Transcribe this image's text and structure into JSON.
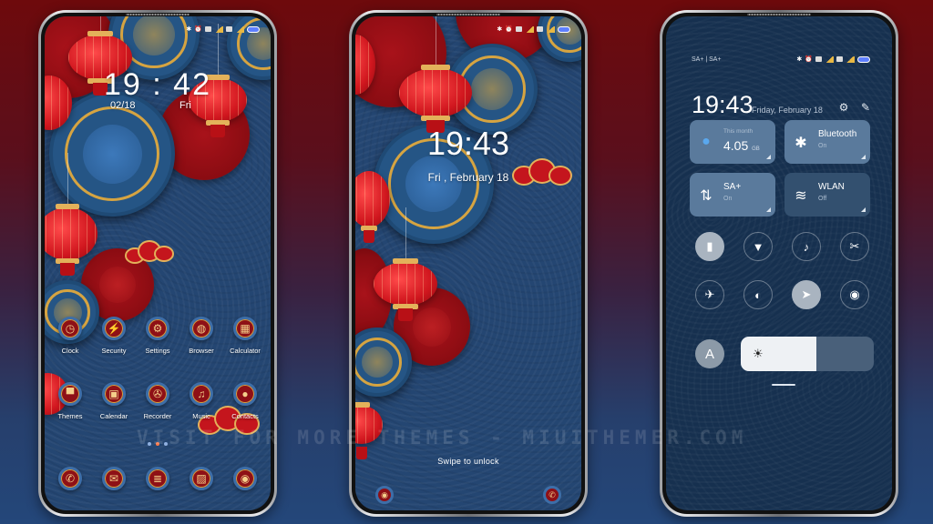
{
  "watermark": "VISIT FOR MORE THEMES - MIUITHEMER.COM",
  "colors": {
    "bg_top": "#6e0a0c",
    "bg_bottom": "#24477a",
    "wallpaper_blue": "#244672",
    "lantern_red": "#d0161e",
    "gold": "#d6a441",
    "cc_background": "#16304f",
    "tile_on": "#5a7a9c",
    "tile_off": "#33506f"
  },
  "home": {
    "status_icons": [
      "bluetooth-icon",
      "alarm-icon",
      "sim1-icon",
      "signal1-icon",
      "sim2-icon",
      "signal2-icon",
      "battery-icon"
    ],
    "clock": "19 : 42",
    "date": "02/18",
    "weekday": "Fri",
    "apps_row1": [
      {
        "label": "Clock",
        "icon": "clock-icon",
        "glyph": "◷"
      },
      {
        "label": "Security",
        "icon": "shield-icon",
        "glyph": "⚡"
      },
      {
        "label": "Settings",
        "icon": "gear-icon",
        "glyph": "⚙"
      },
      {
        "label": "Browser",
        "icon": "globe-icon",
        "glyph": "◍"
      },
      {
        "label": "Calculator",
        "icon": "calculator-icon",
        "glyph": "▦"
      }
    ],
    "apps_row2": [
      {
        "label": "Themes",
        "icon": "shirt-icon",
        "glyph": "▀"
      },
      {
        "label": "Calendar",
        "icon": "calendar-icon",
        "glyph": "▣"
      },
      {
        "label": "Recorder",
        "icon": "recorder-icon",
        "glyph": "✇"
      },
      {
        "label": "Music",
        "icon": "music-icon",
        "glyph": "♫"
      },
      {
        "label": "Contacts",
        "icon": "contact-icon",
        "glyph": "●"
      }
    ],
    "page_count": 3,
    "active_page": 2,
    "dock": [
      {
        "icon": "phone-icon",
        "glyph": "✆"
      },
      {
        "icon": "messages-icon",
        "glyph": "✉"
      },
      {
        "icon": "notes-icon",
        "glyph": "≣"
      },
      {
        "icon": "gallery-icon",
        "glyph": "▨"
      },
      {
        "icon": "camera-icon",
        "glyph": "◉"
      }
    ]
  },
  "lock": {
    "status_icons": [
      "bluetooth-icon",
      "alarm-icon",
      "sim1-icon",
      "signal1-icon",
      "sim2-icon",
      "signal2-icon",
      "battery-icon"
    ],
    "time": "19:43",
    "date": "Fri , February 18",
    "swipe_hint": "Swipe to unlock",
    "left_shortcut": {
      "icon": "camera-icon",
      "glyph": "◉"
    },
    "right_shortcut": {
      "icon": "phone-icon",
      "glyph": "✆"
    }
  },
  "control_center": {
    "carrier": "SA+ | SA+",
    "time": "19:43",
    "date": "Friday, February 18",
    "tiles": [
      {
        "id": "data",
        "small": "This month",
        "value": "4.05",
        "unit": "GB",
        "icon": "water-drop-icon",
        "glyph": "💧",
        "state": "on"
      },
      {
        "id": "bluetooth",
        "title": "Bluetooth",
        "sub": "On",
        "icon": "bluetooth-icon",
        "glyph": "✱",
        "state": "on"
      },
      {
        "id": "mobile-data",
        "title": "SA+",
        "sub": "On",
        "icon": "mobile-data-icon",
        "glyph": "⇅",
        "state": "on"
      },
      {
        "id": "wlan",
        "title": "WLAN",
        "sub": "Off",
        "icon": "wifi-icon",
        "glyph": "≋",
        "state": "off"
      }
    ],
    "toggles": [
      {
        "name": "vibrate",
        "icon": "vibrate-icon",
        "glyph": "▮",
        "on": true
      },
      {
        "name": "flashlight",
        "icon": "flashlight-icon",
        "glyph": "▼",
        "on": false
      },
      {
        "name": "sound",
        "icon": "bell-icon",
        "glyph": "🔔",
        "on": false
      },
      {
        "name": "screenshot",
        "icon": "screenshot-icon",
        "glyph": "✂",
        "on": false
      },
      {
        "name": "airplane",
        "icon": "airplane-icon",
        "glyph": "✈",
        "on": false
      },
      {
        "name": "dark-mode",
        "icon": "dark-mode-icon",
        "glyph": "◐",
        "on": false
      },
      {
        "name": "location",
        "icon": "location-icon",
        "glyph": "➤",
        "on": true
      },
      {
        "name": "reading-mode",
        "icon": "eye-icon",
        "glyph": "◉",
        "on": false
      }
    ],
    "auto_brightness_label": "A",
    "brightness_percent": 57
  }
}
